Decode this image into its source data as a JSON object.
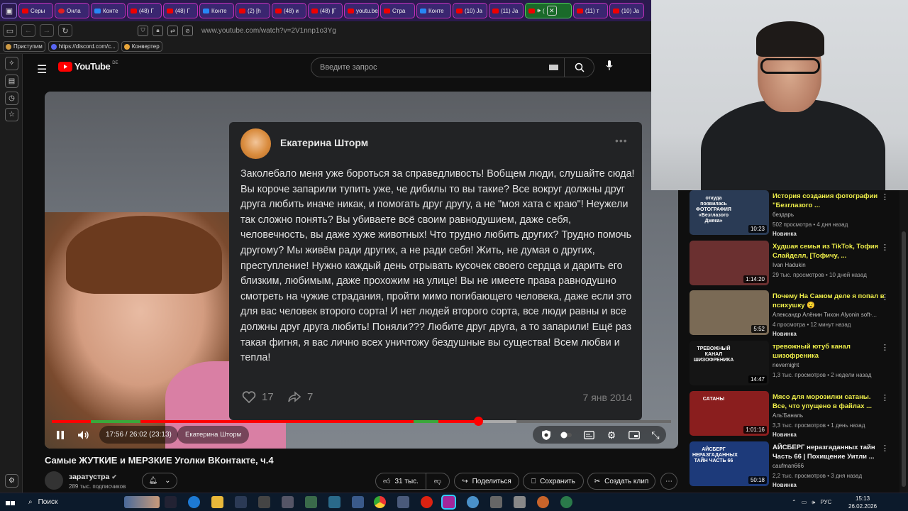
{
  "browser": {
    "tabs": [
      {
        "label": "Серы",
        "fav": "yt"
      },
      {
        "label": "Онла",
        "fav": "g"
      },
      {
        "label": "Конте",
        "fav": "vk"
      },
      {
        "label": "(48) Г",
        "fav": "yt"
      },
      {
        "label": "(48) Г",
        "fav": "yt"
      },
      {
        "label": "Конте",
        "fav": "vk"
      },
      {
        "label": "(2) [h",
        "fav": "yt"
      },
      {
        "label": "(48) и",
        "fav": "yt"
      },
      {
        "label": "(48) [Г",
        "fav": "yt"
      },
      {
        "label": "youtu.be/",
        "fav": "yt"
      },
      {
        "label": "Стра",
        "fav": "yt"
      },
      {
        "label": "Конте",
        "fav": "vk"
      },
      {
        "label": "(10) Ja",
        "fav": "yt"
      },
      {
        "label": "(11) Ja",
        "fav": "yt"
      },
      {
        "label": "(",
        "fav": "yt",
        "active": true
      },
      {
        "label": "(11) т",
        "fav": "yt"
      },
      {
        "label": "(10) Ja",
        "fav": "yt"
      }
    ],
    "url": "www.youtube.com/watch?v=2V1nnp1o3Yg",
    "bookmarks": [
      "Приступим",
      "https://discord.com/c...",
      "Конвертер"
    ]
  },
  "youtube": {
    "logo_text": "YouTube",
    "region": "DE",
    "search_placeholder": "Введите запрос"
  },
  "post": {
    "author": "Екатерина Шторм",
    "text": "Заколебало меня уже бороться за справедливость! Вобщем люди, слушайте сюда! Вы короче запарили тупить уже, че дибилы то вы такие? Все вокруг должны друг друга любить иначе никак, и помогать друг другу, а не \"моя хата с краю\"! Неужели так сложно понять? Вы убиваете всё своим равнодушием, даже себя, человечность, вы даже хуже животных! Что трудно любить других? Трудно помочь другому? Мы живём ради других, а не ради себя! Жить, не думая о других, преступление! Нужно каждый день отрывать кусочек своего сердца и дарить его близким, любимым, даже прохожим на улице! Вы не имеете права равнодушно смотреть на чужие страдания, пройти мимо погибающего человека, даже если это для вас человек второго сорта! И нет людей второго сорта, все люди равны и все должны друг друга любить! Поняли??? Любите друг друга, а то запарили! Ещё раз такая фигня, я вас лично всех уничтожу бездушные вы существа! Всем любви и тепла!",
    "likes": "17",
    "shares": "7",
    "date": "7 янв 2014"
  },
  "player": {
    "time": "17:56 / 26:02 (23:13)",
    "chapter": "Екатерина Шторм",
    "progress_fraction": 0.689,
    "buffered_fraction": 0.75
  },
  "video": {
    "title": "Самые ЖУТКИЕ и МЕРЗКИЕ Уголки ВКонтакте, ч.4",
    "channel": "заратустра",
    "subscribers": "289 тыс. подписчиков",
    "likes": "31 тыс.",
    "share_label": "Поделиться",
    "save_label": "Сохранить",
    "clip_label": "Создать клип"
  },
  "recommendations": [
    {
      "title": "История создания фотографии \"Безглазого ...",
      "channel": "бездарь",
      "meta": "502 просмотра • 4 дня назад",
      "badge": "Новинка",
      "duration": "10:23",
      "thumb_text": "откуда появилась ФОТОГРАФИЯ «Безглазого Джека»",
      "color": "#2a3b55",
      "yellow": true
    },
    {
      "title": "Худшая семья из TikTok, Тофия Слайделл, [Тофичу, ...",
      "channel": "Ivan Hadukin",
      "meta": "29 тыс. просмотров • 10 дней назад",
      "badge": "",
      "duration": "1:14:20",
      "thumb_text": "",
      "color": "#6b3030",
      "yellow": true
    },
    {
      "title": "Почему На Самом деле я попал в психушку 😧",
      "channel": "Александр Алёнин Тихон Alyonin soft-...",
      "meta": "4 просмотра • 12 минут назад",
      "badge": "Новинка",
      "duration": "5:52",
      "thumb_text": "",
      "color": "#7a6a55",
      "yellow": true
    },
    {
      "title": "тревожный ютуб канал шизофреника",
      "channel": "nevernight",
      "meta": "1,3 тыс. просмотров • 2 недели назад",
      "badge": "",
      "duration": "14:47",
      "thumb_text": "ТРЕВОЖНЫЙ КАНАЛ ШИЗОФРЕНИКА",
      "color": "#151515",
      "yellow": true
    },
    {
      "title": "Мясо для морозилки сатаны. Все, что упущено в файлах ...",
      "channel": "Аль'Баналь",
      "meta": "3,3 тыс. просмотров • 1 день назад",
      "badge": "Новинка",
      "duration": "1:01:16",
      "thumb_text": "САТАНЫ",
      "color": "#8a1e1e",
      "yellow": true
    },
    {
      "title": "АЙСБЕРГ неразгаданных тайн Часть 66 | Похищение Уитли ...",
      "channel": "caufman666",
      "meta": "2,2 тыс. просмотров • 3 дня назад",
      "badge": "Новинка",
      "duration": "50:18",
      "thumb_text": "АЙСБЕРГ НЕРАЗГАДАННЫХ ТАЙН ЧАСТЬ 66",
      "color": "#1d3a7a",
      "yellow": false
    }
  ],
  "taskbar": {
    "search_label": "Поиск",
    "lang": "РУС",
    "time": "15:13",
    "date": "26.02.2026"
  }
}
